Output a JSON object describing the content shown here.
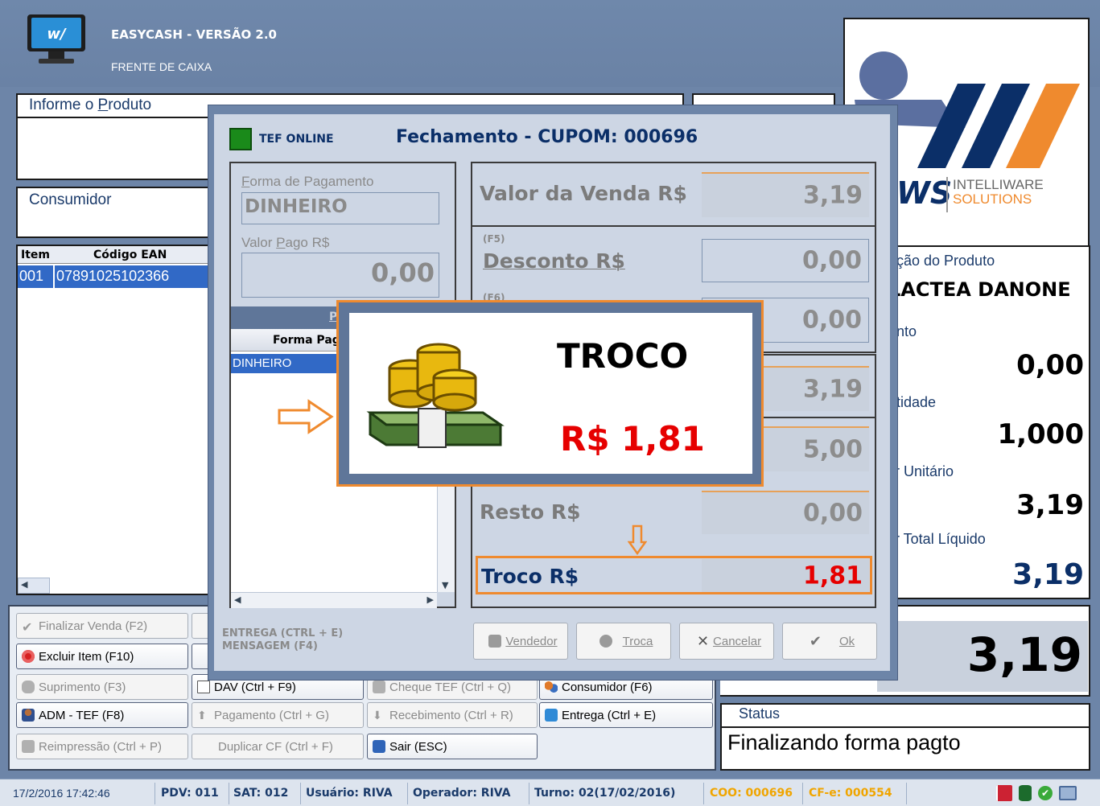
{
  "app": {
    "title": "EASYCASH - VERSÃO 2.0",
    "subtitle": "FRENTE DE CAIXA"
  },
  "left": {
    "product_label_pre": "Informe o ",
    "product_label_key": "P",
    "product_label_post": "roduto",
    "consumer_label": "Consumidor",
    "table": {
      "headers": [
        "Item",
        "Código EAN"
      ],
      "rows": [
        {
          "item": "001",
          "ean": "07891025102366"
        }
      ]
    }
  },
  "right": {
    "desc_label": "rição do Produto",
    "desc_value": "LACTEA DANONE",
    "desconto_label": "onto",
    "desconto_value": "0,00",
    "quantidade_label": "ntidade",
    "quantidade_value": "1,000",
    "unitario_label": "r Unitário",
    "unitario_value": "3,19",
    "total_label": "r Total Líquido",
    "total_value": "3,19",
    "grand_total": "3,19",
    "status_label": "Status",
    "status_value": "Finalizando forma pagto"
  },
  "logo": {
    "brand": "WS",
    "line1": "INTELLIWARE",
    "line2": "SOLUTIONS"
  },
  "buttons": {
    "finalizar": "Finalizar Venda (F2)",
    "excluir": "Excluir Item (F10)",
    "suprimento": "Suprimento (F3)",
    "adm_tef": "ADM - TEF (F8)",
    "reimpressao": "Reimpressão (Ctrl + P)",
    "dav": "DAV (Ctrl + F9)",
    "pagamento": "Pagamento (Ctrl + G)",
    "duplicar": "Duplicar CF (Ctrl + F)",
    "cheque_tef": "Cheque TEF (Ctrl + Q)",
    "recebimento": "Recebimento (Ctrl + R)",
    "sair": "Sair (ESC)",
    "consumidor": "Consumidor (F6)",
    "entrega": "Entrega (Ctrl + E)"
  },
  "dialog": {
    "tef_status": "TEF ONLINE",
    "title": "Fechamento - CUPOM: 000696",
    "forma_label_key": "F",
    "forma_label_rest": "orma de Pagamento",
    "forma_value": "DINHEIRO",
    "valor_pago_label_pre": "Valor ",
    "valor_pago_label_key": "P",
    "valor_pago_label_post": "ago R$",
    "valor_pago_value": "0,00",
    "pagamentos_header": "Paga",
    "grid_header": "Forma Pagto.",
    "grid_rows": [
      "DINHEIRO"
    ],
    "valor_venda_label": "Valor da Venda R$",
    "valor_venda_value": "3,19",
    "f5_hint": "(F5)",
    "desconto_label": "Desconto R$",
    "desconto_value": "0,00",
    "f6_hint": "(F6)",
    "acrescimo_value": "0,00",
    "total_value": "3,19",
    "pago_value": "5,00",
    "resto_label": "Resto R$",
    "resto_value": "0,00",
    "troco_label": "Troco R$",
    "troco_value": "1,81",
    "hint_entrega": "ENTREGA (CTRL + E)",
    "hint_mensagem": "MENSAGEM (F4)",
    "btn_vendedor": "Vendedor",
    "btn_troca": "Troca",
    "btn_cancelar": "Cancelar",
    "btn_ok": "Ok"
  },
  "popup": {
    "title": "TROCO",
    "value": "R$ 1,81"
  },
  "statusbar": {
    "datetime": "17/2/2016 17:42:46",
    "pdv": "PDV: 011",
    "sat": "SAT: 012",
    "usuario": "Usuário: RIVA",
    "operador": "Operador: RIVA",
    "turno": "Turno: 02(17/02/2016)",
    "coo": "COO: 000696",
    "cfe": "CF-e: 000554"
  },
  "colors": {
    "accent_orange": "#ef8a2e",
    "troco_red": "#e60000",
    "tef_green": "#1a8a1a",
    "selection_blue": "#3169c6"
  }
}
